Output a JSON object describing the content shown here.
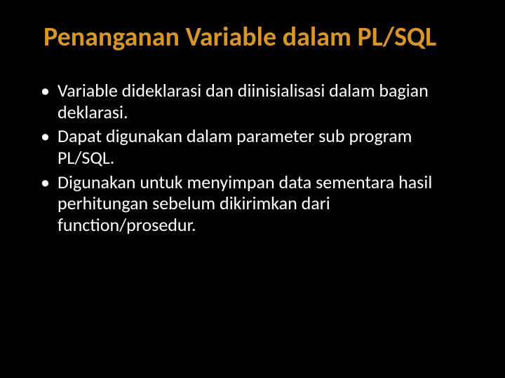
{
  "slide": {
    "title": "Penanganan Variable dalam PL/SQL",
    "bullets": [
      "Variable dideklarasi dan diinisialisasi dalam bagian deklarasi.",
      "Dapat digunakan dalam parameter sub program PL/SQL.",
      "Digunakan untuk menyimpan data sementara hasil perhitungan sebelum dikirimkan dari function/prosedur."
    ]
  }
}
